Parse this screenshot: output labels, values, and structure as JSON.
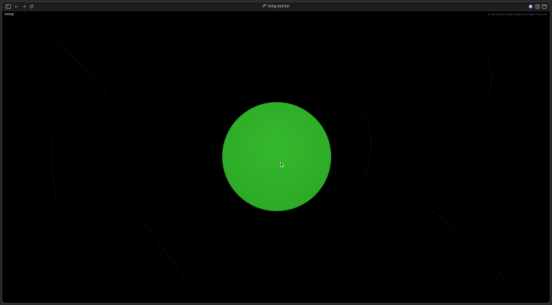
{
  "browser": {
    "url": "boing.naut.fun"
  },
  "page": {
    "site_title": "boing!",
    "credit": "a Thursday evening creation by Rupert Chen.ldn"
  },
  "colors": {
    "background": "#000000",
    "orb": "#2fae28",
    "toolbar": "#1c1c1e"
  }
}
